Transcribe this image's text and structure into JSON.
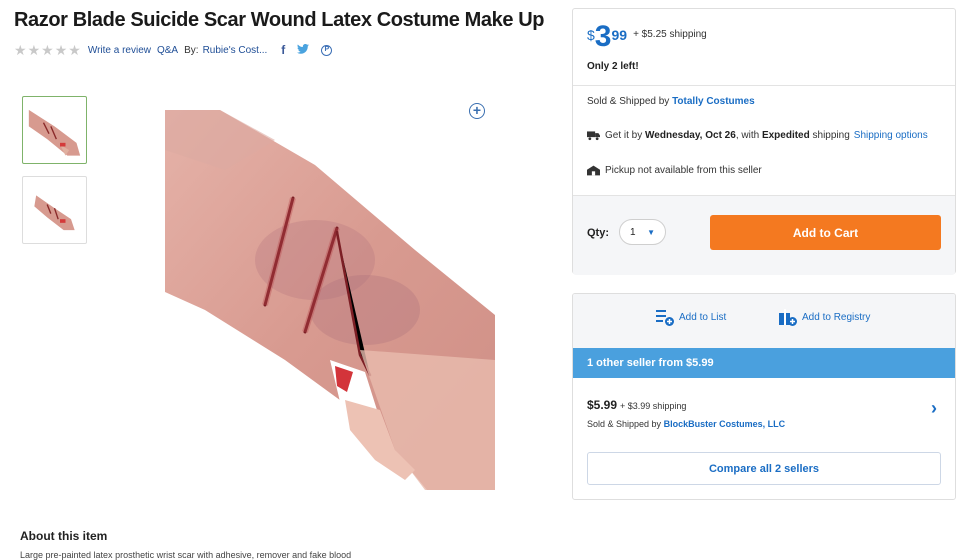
{
  "product": {
    "title": "Razor Blade Suicide Scar Wound Latex Costume Make Up",
    "write_review": "Write a review",
    "qa": "Q&A",
    "by_label": "By:",
    "brand": "Rubie's Cost..."
  },
  "buybox": {
    "currency": "$",
    "price_int": "3",
    "price_cents": "99",
    "shipping": "+ $5.25 shipping",
    "stock": "Only 2 left!",
    "sold_prefix": "Sold & Shipped by",
    "seller": "Totally Costumes",
    "delivery_prefix": "Get it by",
    "delivery_date": "Wednesday, Oct 26",
    "delivery_mid": ", with",
    "delivery_method": "Expedited",
    "delivery_suffix": "shipping",
    "shipping_options": "Shipping options",
    "pickup": "Pickup not available from this seller",
    "qty_label": "Qty:",
    "qty_value": "1",
    "add_to_cart": "Add to Cart"
  },
  "list": {
    "add_to_list": "Add to List",
    "add_to_registry": "Add to Registry",
    "other_sellers": "1 other seller from $5.99",
    "other_price": "$5.99",
    "other_shipping": "+ $3.99 shipping",
    "other_sold_prefix": "Sold & Shipped by",
    "other_seller": "BlockBuster Costumes, LLC",
    "compare": "Compare all 2 sellers"
  },
  "about": {
    "heading": "About this item",
    "description": "Large pre-painted latex prosthetic wrist scar with adhesive, remover and fake blood"
  },
  "colors": {
    "accent": "#1a6dc4",
    "cart": "#f47920",
    "others_bar": "#4aa0de"
  }
}
